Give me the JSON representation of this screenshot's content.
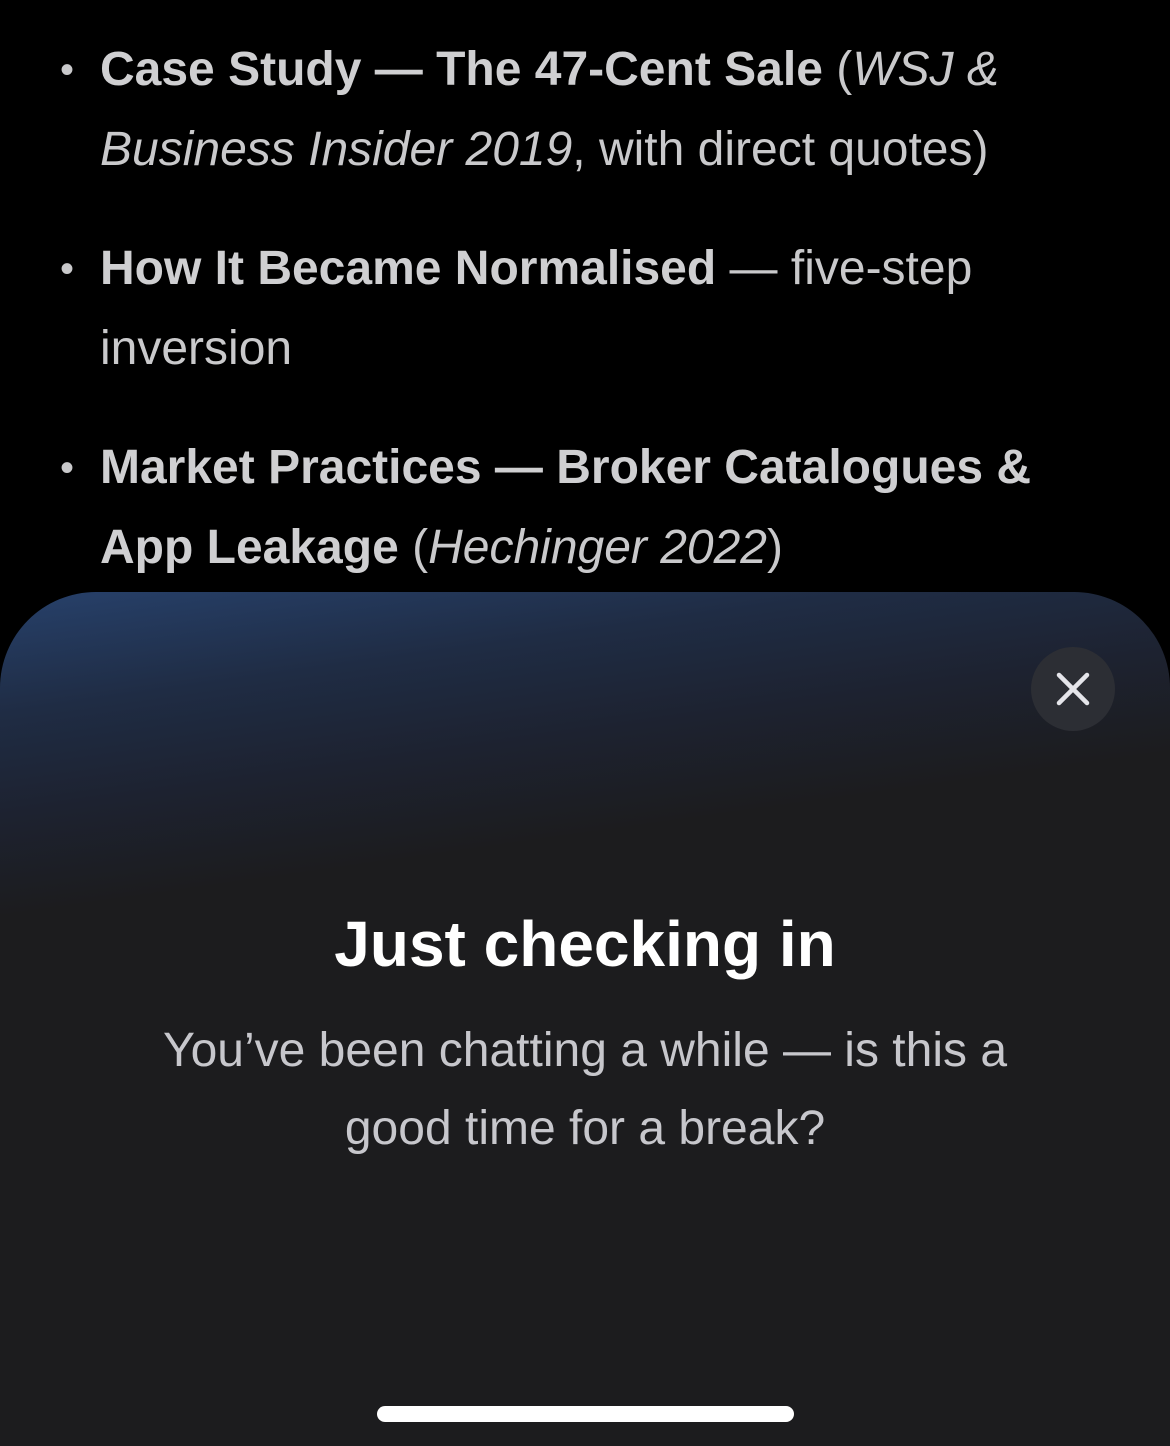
{
  "chat": {
    "items": [
      {
        "bold": "Case Study — The 47-Cent Sale",
        "open": " (",
        "italic": "WSJ & Business Insider 2019",
        "rest": ", with direct quotes)"
      },
      {
        "bold": "How It Became Normalised",
        "rest": " — five-step inversion"
      },
      {
        "bold": "Market Practices — Broker Catalogues & App Leakage",
        "open": " (",
        "italic": "Hechinger 2022",
        "rest": ")"
      }
    ]
  },
  "sheet": {
    "title": "Just checking in",
    "body": "You’ve been chatting a while — is this a good time for a break?",
    "close_icon": "close-icon"
  },
  "colors": {
    "background": "#000000",
    "sheet": "#1c1c1e",
    "sheet_gradient_top": "#27416b",
    "text_primary": "#ffffff",
    "text_secondary": "#c7c7cc"
  }
}
